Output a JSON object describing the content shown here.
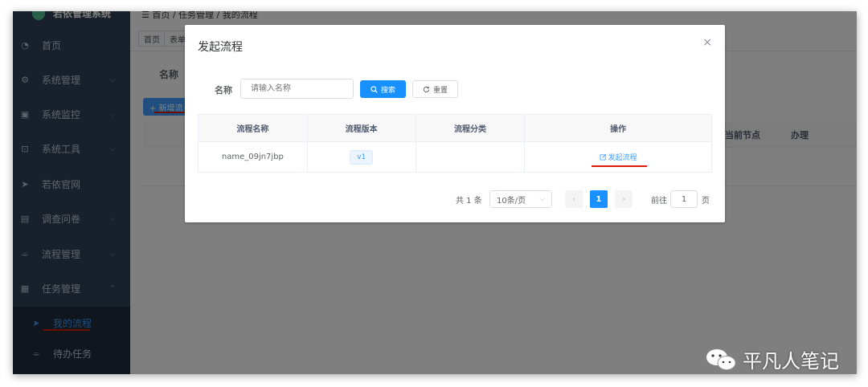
{
  "app": {
    "title": "若依管理系统"
  },
  "sidebar": {
    "items": [
      {
        "label": "首页",
        "icon": "dashboard-icon",
        "glyph": "◔"
      },
      {
        "label": "系统管理",
        "icon": "gear-icon",
        "glyph": "⚙"
      },
      {
        "label": "系统监控",
        "icon": "monitor-icon",
        "glyph": "▣"
      },
      {
        "label": "系统工具",
        "icon": "tool-icon",
        "glyph": "⊡"
      },
      {
        "label": "若依官网",
        "icon": "send-icon",
        "glyph": "➤"
      },
      {
        "label": "调查问卷",
        "icon": "message-icon",
        "glyph": "▤"
      },
      {
        "label": "流程管理",
        "icon": "flow-icon",
        "glyph": "⌯"
      },
      {
        "label": "任务管理",
        "icon": "task-icon",
        "glyph": "▦"
      }
    ],
    "submenu": [
      {
        "label": "我的流程",
        "icon": "send-icon",
        "glyph": "➤"
      },
      {
        "label": "待办任务",
        "icon": "flow-icon",
        "glyph": "⌯"
      }
    ]
  },
  "navbar": {
    "breadcrumb": "☰   首页  /  任务管理  /  我的流程"
  },
  "tags": [
    "首页",
    "表单"
  ],
  "background": {
    "name_label": "名称",
    "add_button": "+ 新增流",
    "col_current_node": "当前节点",
    "col_handle": "办理"
  },
  "dialog": {
    "title": "发起流程",
    "close": "×",
    "name_label": "名称",
    "name_placeholder": "请输入名称",
    "search_button": "搜索",
    "reset_button": "重置",
    "table": {
      "headers": [
        "流程名称",
        "流程版本",
        "流程分类",
        "操作"
      ],
      "rows": [
        {
          "name": "name_09jn7jbp",
          "version": "v1",
          "category": "",
          "action": "发起流程"
        }
      ]
    },
    "pagination": {
      "total": "共 1 条",
      "page_size": "10条/页",
      "current_page": "1",
      "goto_label": "前往",
      "goto_value": "1",
      "page_unit": "页"
    }
  },
  "watermark": "平凡人笔记",
  "colors": {
    "primary": "#1890ff",
    "sidebar": "#304156",
    "annotation": "#d81e06"
  }
}
